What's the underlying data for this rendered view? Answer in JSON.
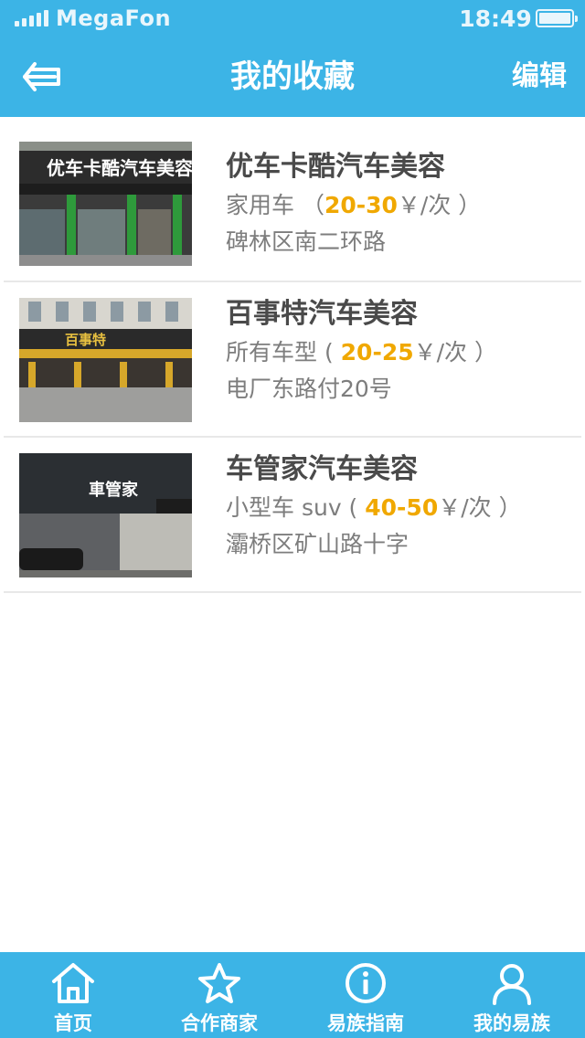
{
  "status": {
    "carrier": "MegaFon",
    "time": "18:49",
    "battery_level": 1.0
  },
  "nav": {
    "title": "我的收藏",
    "edit_label": "编辑",
    "back_icon": "back-arrow-icon"
  },
  "favorites": [
    {
      "name": "优车卡酷汽车美容",
      "car_type": "家用车 （",
      "price": "20-30",
      "unit": "￥/次 ）",
      "address": "碑林区南二环路",
      "photo_sign": "优车卡酷汽车美容"
    },
    {
      "name": "百事特汽车美容",
      "car_type": "所有车型 ( ",
      "price": "20-25",
      "unit": "￥/次 ）",
      "address": "电厂东路付20号",
      "photo_sign": "百事特"
    },
    {
      "name": "车管家汽车美容",
      "car_type": "小型车  suv ( ",
      "price": "40-50",
      "unit": "￥/次 ）",
      "address": "灞桥区矿山路十字",
      "photo_sign": "車管家"
    }
  ],
  "tabs": [
    {
      "label": "首页",
      "icon": "home-icon"
    },
    {
      "label": "合作商家",
      "icon": "star-icon"
    },
    {
      "label": "易族指南",
      "icon": "info-icon"
    },
    {
      "label": "我的易族",
      "icon": "user-icon"
    }
  ],
  "colors": {
    "brand": "#3cb4e6",
    "price": "#f0a800",
    "title_text": "#4a4a4a",
    "secondary_text": "#7d7d7d"
  }
}
